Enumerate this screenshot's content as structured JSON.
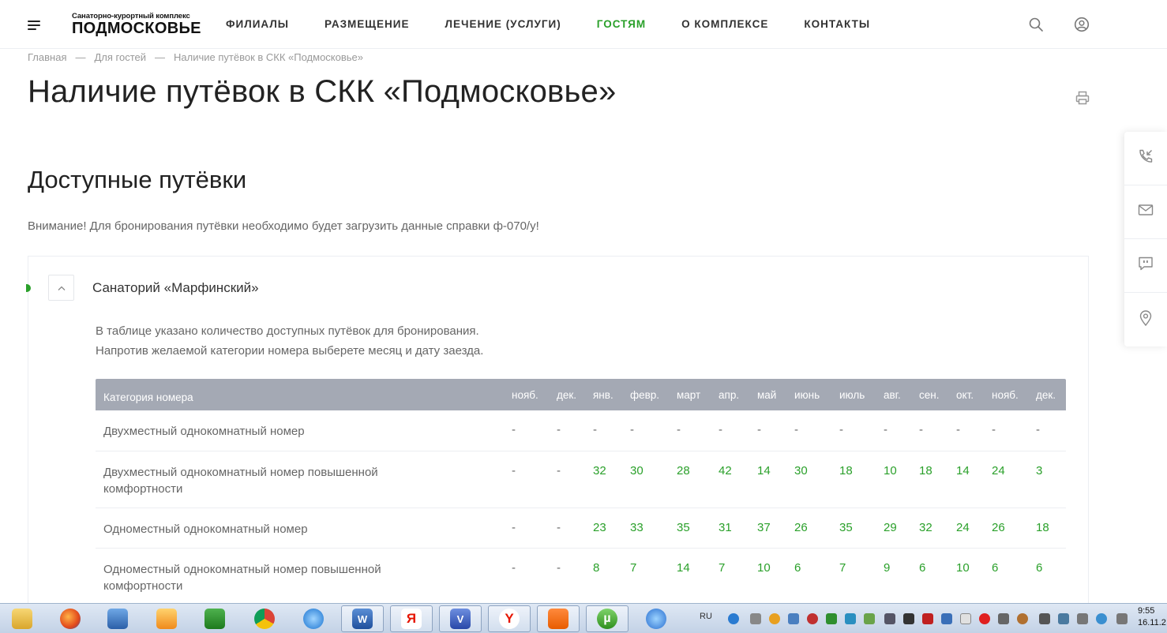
{
  "header": {
    "logo_subtitle": "Санаторно-курортный комплекс",
    "logo_title": "ПОДМОСКОВЬЕ",
    "nav": [
      "ФИЛИАЛЫ",
      "РАЗМЕЩЕНИЕ",
      "ЛЕЧЕНИЕ (УСЛУГИ)",
      "ГОСТЯМ",
      "О КОМПЛЕКСЕ",
      "КОНТАКТЫ"
    ],
    "active_nav": "ГОСТЯМ",
    "icons": [
      "menu-icon",
      "search-icon",
      "user-icon"
    ]
  },
  "breadcrumb": [
    "Главная",
    "Для гостей",
    "Наличие путёвок в СКК «Подмосковье»"
  ],
  "breadcrumb_sep": "—",
  "page_title": "Наличие путёвок в СКК «Подмосковье»",
  "section_title": "Доступные путёвки",
  "notice": "Внимание! Для бронирования путёвки необходимо будет загрузить данные справки ф-070/у!",
  "side_panel_icons": [
    "callback-icon",
    "mail-icon",
    "chat-icon",
    "location-icon"
  ],
  "accordion": {
    "title": "Санаторий «Марфинский»",
    "desc_line1": "В таблице указано количество доступных путёвок для бронирования.",
    "desc_line2": "Напротив желаемой категории номера выберете месяц и дату заезда."
  },
  "table": {
    "category_header": "Категория номера",
    "months": [
      "нояб.",
      "дек.",
      "янв.",
      "февр.",
      "март",
      "апр.",
      "май",
      "июнь",
      "июль",
      "авг.",
      "сен.",
      "окт.",
      "нояб.",
      "дек."
    ],
    "rows": [
      {
        "category": "Двухместный однокомнатный номер",
        "values": [
          "-",
          "-",
          "-",
          "-",
          "-",
          "-",
          "-",
          "-",
          "-",
          "-",
          "-",
          "-",
          "-",
          "-"
        ]
      },
      {
        "category_line1": "Двухместный однокомнатный номер повышенной",
        "category_line2": "комфортности",
        "values": [
          "-",
          "-",
          "32",
          "30",
          "28",
          "42",
          "14",
          "30",
          "18",
          "10",
          "18",
          "14",
          "24",
          "3"
        ]
      },
      {
        "category": "Одноместный однокомнатный номер",
        "values": [
          "-",
          "-",
          "23",
          "33",
          "35",
          "31",
          "37",
          "26",
          "35",
          "29",
          "32",
          "24",
          "26",
          "18"
        ]
      },
      {
        "category_line1": "Одноместный однокомнатный номер повышенной",
        "category_line2": "комфортности",
        "values": [
          "-",
          "-",
          "8",
          "7",
          "14",
          "7",
          "10",
          "6",
          "7",
          "9",
          "6",
          "10",
          "6",
          "6"
        ]
      }
    ]
  },
  "colors": {
    "accent": "#2aa02a",
    "table_header": "#a4a9b4",
    "text": "#333333",
    "muted": "#666666"
  },
  "taskbar": {
    "apps": [
      "explorer-icon",
      "firefox-icon",
      "media-player-icon",
      "video-icon",
      "excel-icon",
      "chrome-icon",
      "ie-icon",
      "word-icon",
      "yandex-icon",
      "visio-icon",
      "yandex-browser-icon",
      "odnoklassniki-icon",
      "utorrent-icon",
      "app-icon"
    ],
    "word_glyph": "W",
    "yandex_glyph": "Я",
    "visio_glyph": "V",
    "ybrowser_glyph": "Y",
    "utorrent_glyph": "µ",
    "lang": "RU",
    "time": "9:55",
    "date": "16.11.2"
  }
}
